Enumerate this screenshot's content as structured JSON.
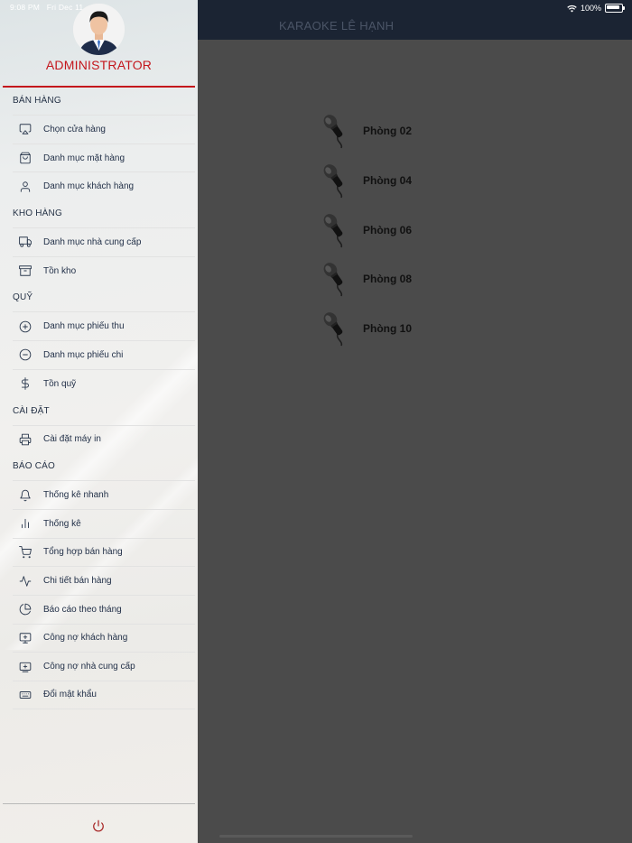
{
  "status_bar": {
    "time": "9:08 PM",
    "date": "Fri Dec 11",
    "battery": "100%"
  },
  "header": {
    "title": "KARAOKE LÊ HẠNH"
  },
  "drawer": {
    "user_name": "ADMINISTRATOR",
    "sections": [
      {
        "title": "BÁN HÀNG",
        "items": [
          {
            "label": "Chọn cửa hàng",
            "icon": "airplay-icon"
          },
          {
            "label": "Danh mục mặt hàng",
            "icon": "shopping-bag-icon"
          },
          {
            "label": "Danh mục khách hàng",
            "icon": "user-icon"
          }
        ]
      },
      {
        "title": "KHO HÀNG",
        "items": [
          {
            "label": "Danh mục nhà cung cấp",
            "icon": "truck-icon"
          },
          {
            "label": "Tồn kho",
            "icon": "archive-icon"
          }
        ]
      },
      {
        "title": "QUỸ",
        "items": [
          {
            "label": "Danh mục phiếu thu",
            "icon": "plus-circle-icon"
          },
          {
            "label": "Danh mục phiếu chi",
            "icon": "minus-circle-icon"
          },
          {
            "label": "Tồn quỹ",
            "icon": "dollar-icon"
          }
        ]
      },
      {
        "title": "CÀI ĐẶT",
        "items": [
          {
            "label": "Cài đặt máy in",
            "icon": "printer-icon"
          }
        ]
      },
      {
        "title": "BÁO CÁO",
        "items": [
          {
            "label": "Thống kê nhanh",
            "icon": "bell-icon"
          },
          {
            "label": "Thống kê",
            "icon": "bar-chart-icon"
          },
          {
            "label": "Tổng hợp bán hàng",
            "icon": "cart-icon"
          },
          {
            "label": "Chi tiết bán hàng",
            "icon": "activity-icon"
          },
          {
            "label": "Báo cáo theo tháng",
            "icon": "pie-chart-icon"
          },
          {
            "label": "Công nợ khách hàng",
            "icon": "monitor-plus-icon"
          },
          {
            "label": "Công nợ nhà cung cấp",
            "icon": "tv-plus-icon"
          },
          {
            "label": "Đổi mật khẩu",
            "icon": "keyboard-icon"
          }
        ]
      }
    ],
    "logout_icon": "power-icon"
  },
  "rooms": [
    {
      "label": "Phòng 02",
      "icon": "microphone-icon"
    },
    {
      "label": "Phòng 04",
      "icon": "microphone-icon"
    },
    {
      "label": "Phòng 06",
      "icon": "microphone-icon"
    },
    {
      "label": "Phòng 08",
      "icon": "microphone-icon"
    },
    {
      "label": "Phòng 10",
      "icon": "microphone-icon"
    }
  ],
  "colors": {
    "accent": "#c4161c",
    "navbar": "#1b2433",
    "overlay": "#4b4b4b"
  }
}
